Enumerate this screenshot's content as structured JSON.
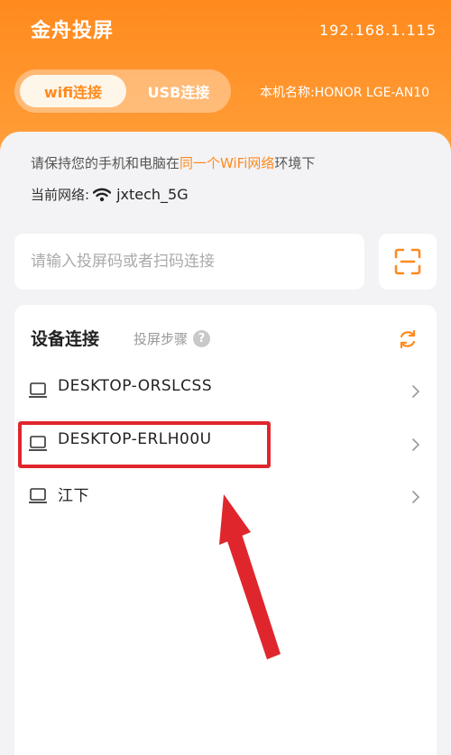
{
  "header": {
    "title": "金舟投屏",
    "ip": "192.168.1.115",
    "tabs": [
      {
        "label": "wifi连接",
        "active": true
      },
      {
        "label": "USB连接",
        "active": false
      }
    ],
    "device_name": "本机名称:HONOR  LGE-AN10"
  },
  "network": {
    "hint_prefix": "请保持您的手机和电脑在",
    "hint_highlight": "同一个WiFi网络",
    "hint_suffix": "环境下",
    "current_label": "当前网络:",
    "ssid": "jxtech_5G"
  },
  "search": {
    "placeholder": "请输入投屏码或者扫码连接",
    "value": ""
  },
  "devices": {
    "title": "设备连接",
    "steps_label": "投屏步骤",
    "items": [
      {
        "name": "DESKTOP-ORSLCSS"
      },
      {
        "name": "DESKTOP-ERLH00U"
      },
      {
        "name": "江下"
      }
    ]
  },
  "colors": {
    "accent": "#ff8a1e",
    "highlight_box": "#e0262d"
  },
  "icons": [
    "wifi-icon",
    "scan-icon",
    "help-icon",
    "refresh-icon",
    "computer-icon",
    "chevron-right-icon"
  ]
}
